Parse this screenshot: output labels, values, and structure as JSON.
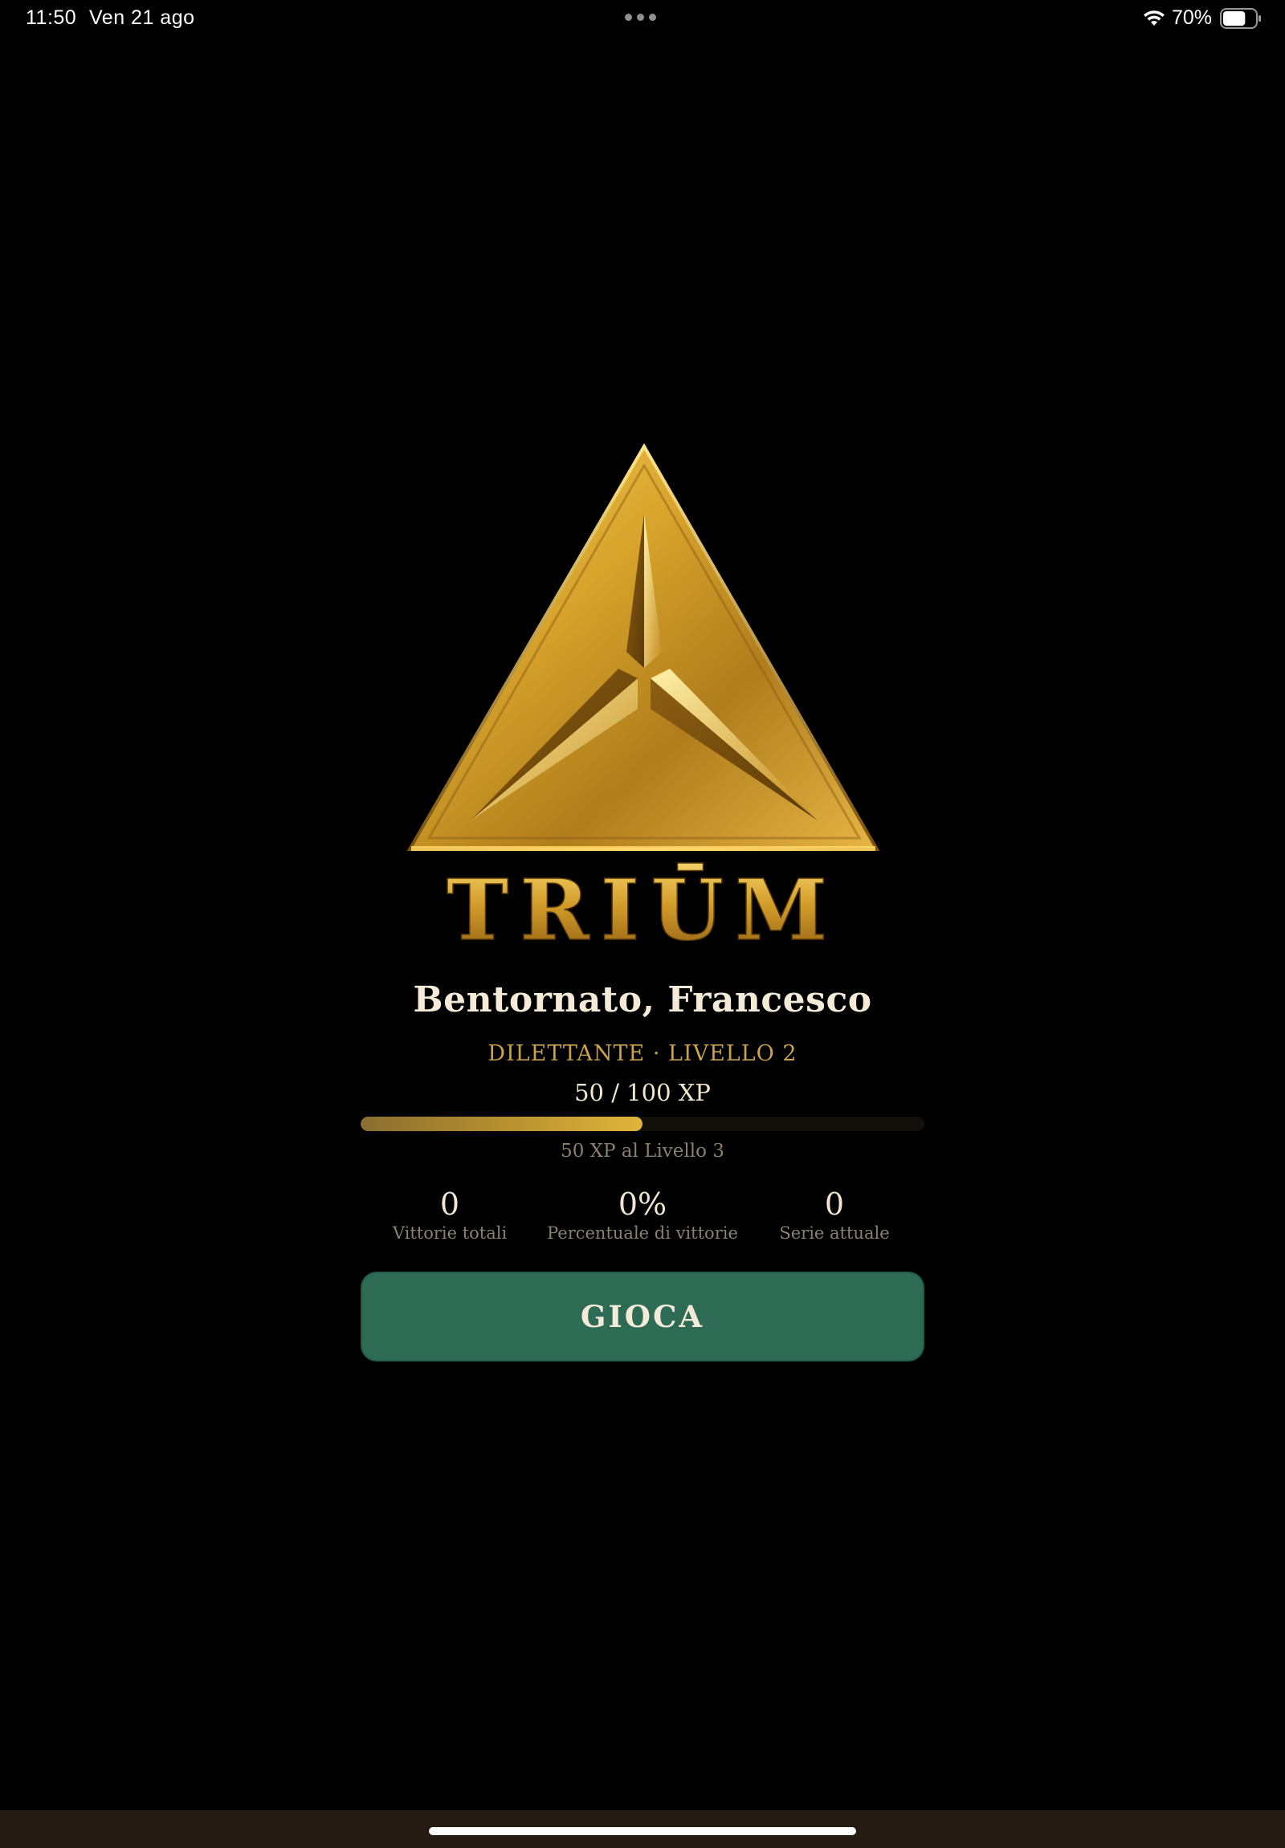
{
  "status_bar": {
    "time": "11:50",
    "date": "Ven 21 ago",
    "battery_percent": "70%",
    "battery_level": 0.7,
    "icons": [
      "wifi-icon",
      "battery-icon",
      "multitask-dots-icon"
    ]
  },
  "logo": {
    "brand_text": "TRIŪM",
    "icon": "golden-triangle-emblem-icon"
  },
  "welcome": {
    "title": "Bentornato, Francesco",
    "level_label": "DILETTANTE · LIVELLO 2",
    "xp_value": "50 / 100 XP",
    "xp_progress": 0.5,
    "xp_remaining": "50 XP al Livello 3"
  },
  "stats": [
    {
      "value": "0",
      "label": "Vittorie totali"
    },
    {
      "value": "0%",
      "label": "Percentuale di vittorie"
    },
    {
      "value": "0",
      "label": "Serie attuale"
    }
  ],
  "play_button": {
    "label": "GIOCA"
  },
  "colors": {
    "background": "#000000",
    "gold": "#c9a24a",
    "play_button": "#2d6b54",
    "text_primary": "#f1e6cf",
    "text_muted": "#8a8070"
  }
}
